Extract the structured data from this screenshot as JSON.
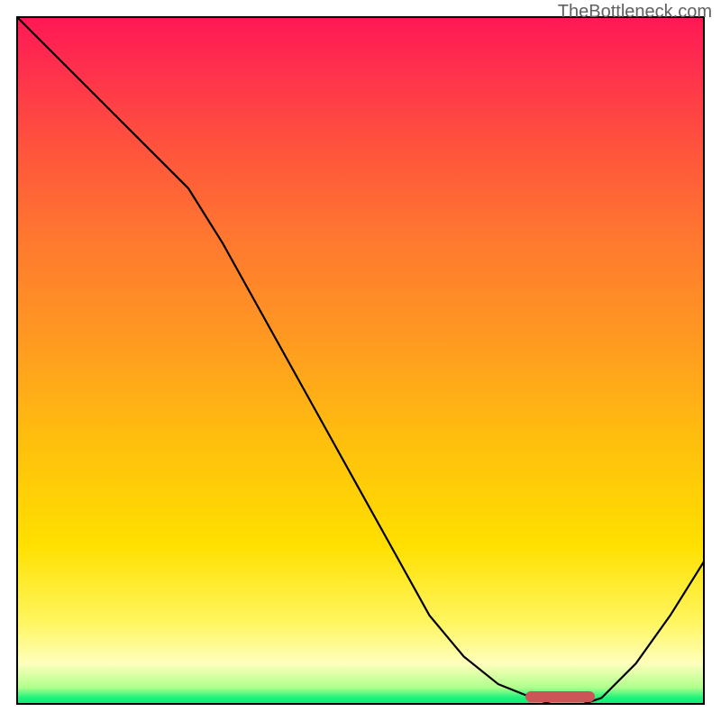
{
  "watermark": "TheBottleneck.com",
  "chart_data": {
    "type": "line",
    "title": "",
    "xlabel": "",
    "ylabel": "",
    "x": [
      0,
      5,
      10,
      15,
      20,
      25,
      30,
      35,
      40,
      45,
      50,
      55,
      60,
      65,
      70,
      75,
      78,
      82,
      85,
      90,
      95,
      100
    ],
    "values": [
      100,
      95,
      90,
      85,
      80,
      75,
      67,
      58,
      49,
      40,
      31,
      22,
      13,
      7,
      3,
      1,
      0,
      0,
      1,
      6,
      13,
      21
    ],
    "xlim": [
      0,
      100
    ],
    "ylim": [
      0,
      100
    ],
    "marker": {
      "x_start": 74,
      "x_end": 84,
      "y": 0
    },
    "gradient_stops": [
      {
        "pos": 0,
        "color": "#ff1754"
      },
      {
        "pos": 0.5,
        "color": "#ffc00d"
      },
      {
        "pos": 0.9,
        "color": "#ffff8a"
      },
      {
        "pos": 1.0,
        "color": "#19e878"
      }
    ]
  }
}
